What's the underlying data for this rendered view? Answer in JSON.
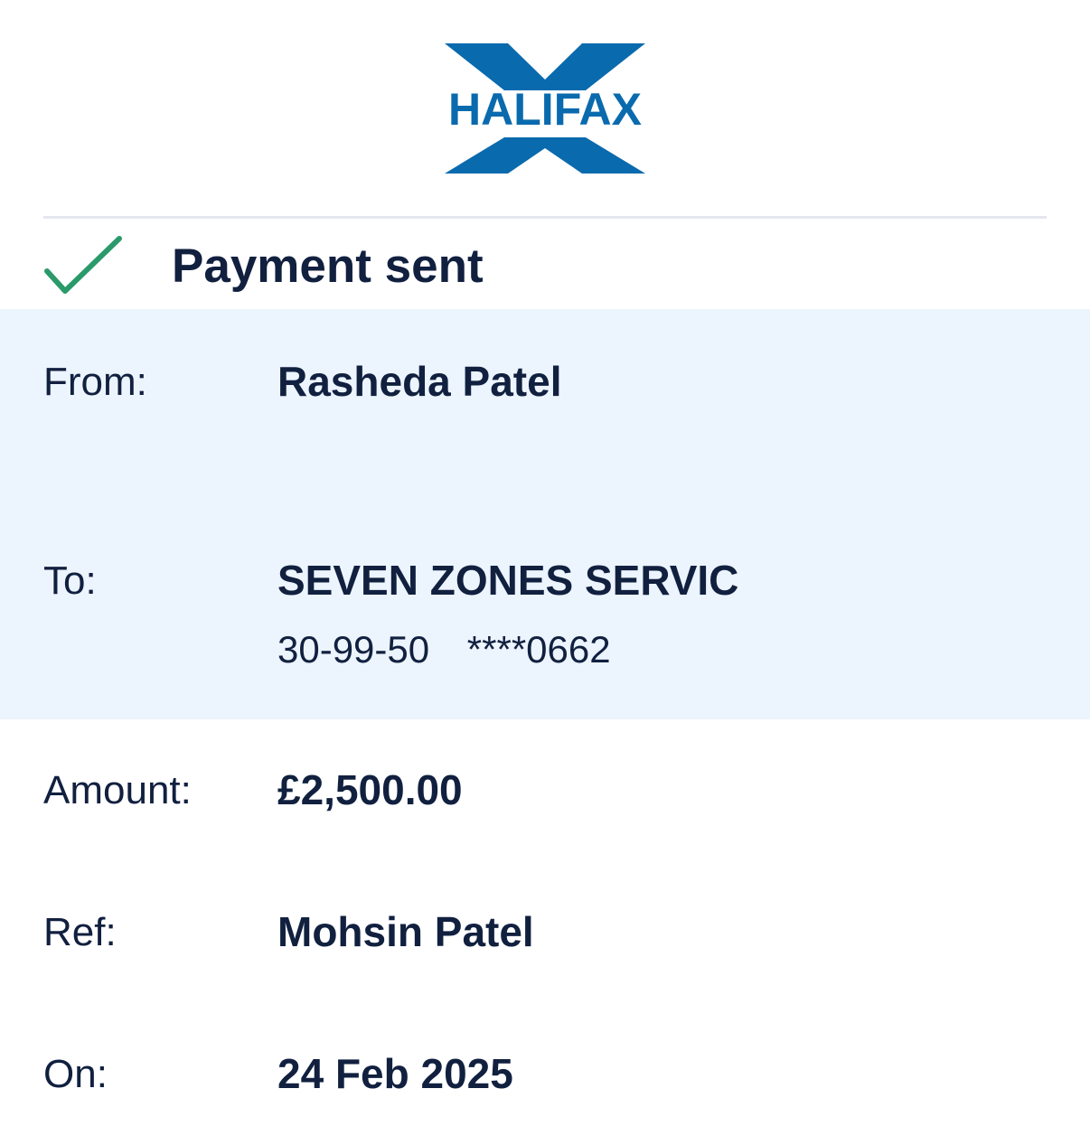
{
  "brand": {
    "logo_text": "HALIFAX",
    "logo_color": "#0a6aae"
  },
  "status": {
    "title": "Payment sent",
    "icon": "check-icon",
    "icon_color": "#2a9a6a"
  },
  "details": {
    "from": {
      "label": "From:",
      "value": "Rasheda Patel"
    },
    "to": {
      "label": "To:",
      "value": "SEVEN ZONES SERVIC",
      "sort_code": "30-99-50",
      "account_number": "****0662"
    },
    "amount": {
      "label": "Amount:",
      "value": "£2,500.00"
    },
    "ref": {
      "label": "Ref:",
      "value": "Mohsin Patel"
    },
    "on": {
      "label": "On:",
      "value": "24 Feb 2025"
    }
  },
  "colors": {
    "text": "#11203f",
    "shaded_background": "#ecf4fd",
    "divider": "#e6e7ee"
  }
}
